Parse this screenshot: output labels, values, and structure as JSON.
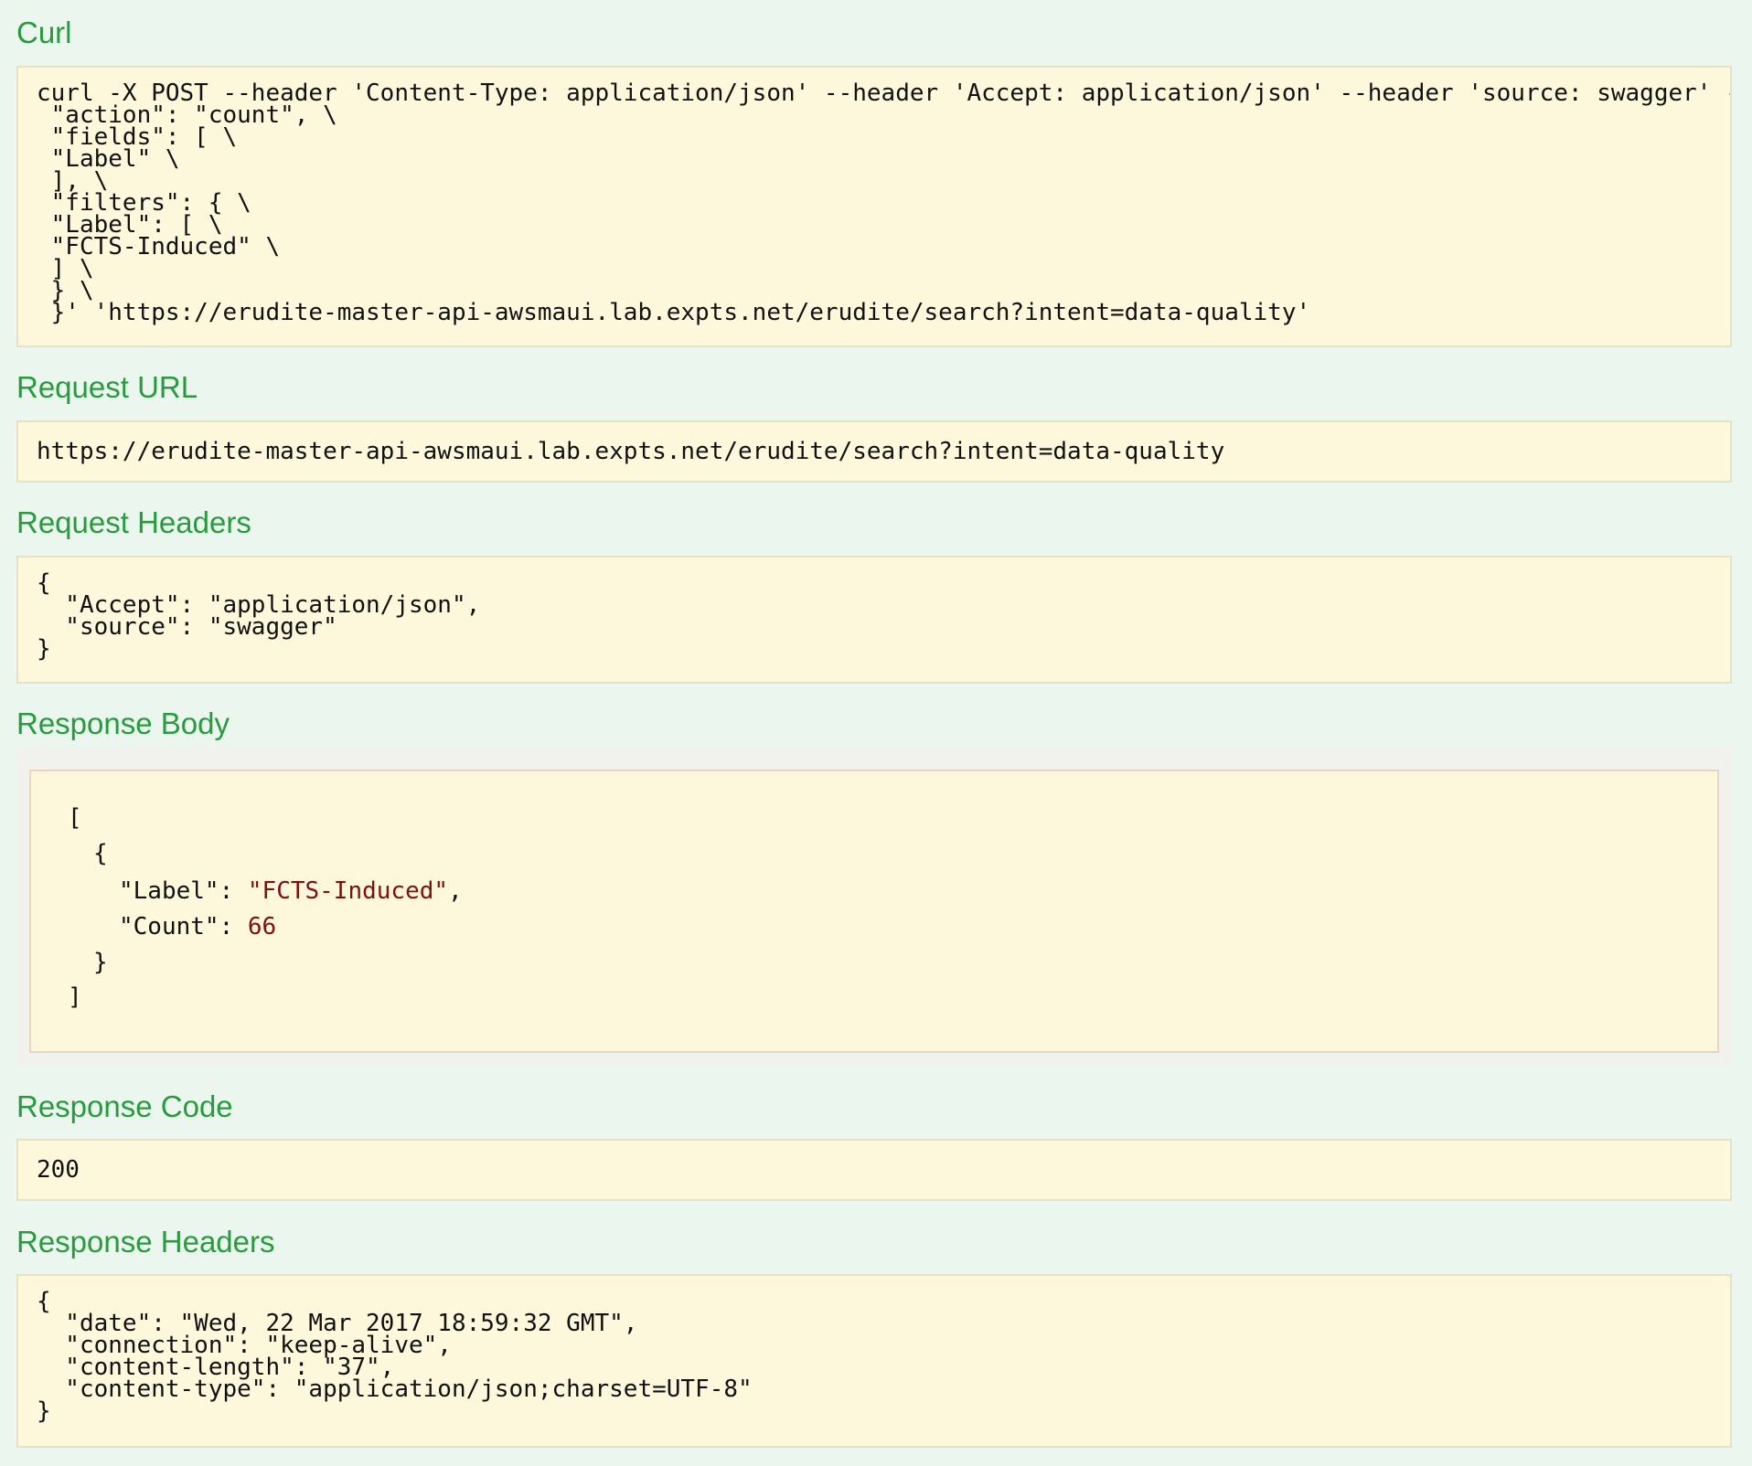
{
  "curl": {
    "title": "Curl",
    "lines": [
      "curl -X POST --header 'Content-Type: application/json' --header 'Accept: application/json' --header 'source: swagger' -",
      " \"action\": \"count\", \\",
      " \"fields\": [ \\",
      " \"Label\" \\",
      " ], \\",
      " \"filters\": { \\",
      " \"Label\": [ \\",
      " \"FCTS-Induced\" \\",
      " ] \\",
      " } \\",
      " }' 'https://erudite-master-api-awsmaui.lab.expts.net/erudite/search?intent=data-quality'"
    ]
  },
  "request_url": {
    "title": "Request URL",
    "value": "https://erudite-master-api-awsmaui.lab.expts.net/erudite/search?intent=data-quality"
  },
  "request_headers": {
    "title": "Request Headers",
    "lines": [
      "{",
      "  \"Accept\": \"application/json\",",
      "  \"source\": \"swagger\"",
      "}"
    ]
  },
  "response_body": {
    "title": "Response Body",
    "open_array": "[",
    "open_object": "{",
    "label_key": "\"Label\": ",
    "label_value": "\"FCTS-Induced\"",
    "label_comma": ",",
    "count_key": "\"Count\": ",
    "count_value": "66",
    "close_object": "}",
    "close_array": "]"
  },
  "response_code": {
    "title": "Response Code",
    "value": "200"
  },
  "response_headers": {
    "title": "Response Headers",
    "lines": [
      "{",
      "  \"date\": \"Wed, 22 Mar 2017 18:59:32 GMT\",",
      "  \"connection\": \"keep-alive\",",
      "  \"content-length\": \"37\",",
      "  \"content-type\": \"application/json;charset=UTF-8\"",
      "}"
    ]
  },
  "colors": {
    "page_background": "#ebf6ef",
    "title_green": "#299b3f",
    "code_background": "#fdf7dc",
    "json_value": "#7d1212"
  }
}
